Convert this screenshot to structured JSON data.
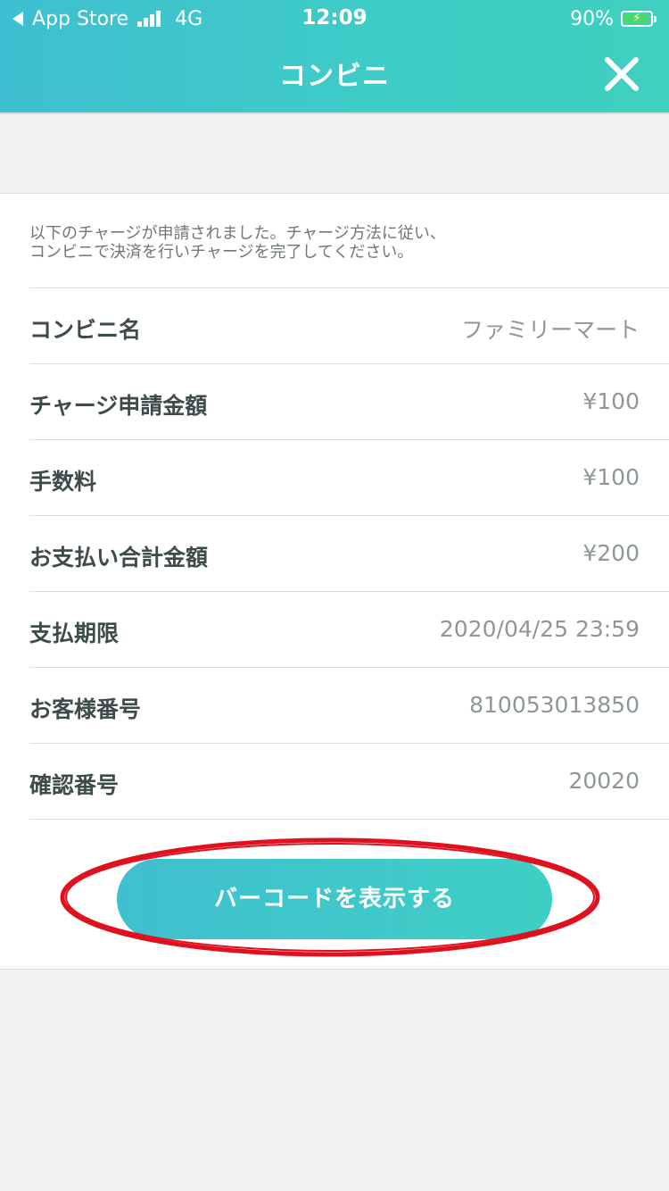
{
  "status_bar": {
    "back_app": "App Store",
    "network": "4G",
    "time": "12:09",
    "battery": "90%",
    "battery_level": 0.9,
    "battery_color": "#4cd964"
  },
  "nav": {
    "title": "コンビニ",
    "close_icon": "close-icon"
  },
  "notice": {
    "line1": "以下のチャージが申請されました。チャージ方法に従い、",
    "line2": "コンビニで決済を行いチャージを完了してください。"
  },
  "details": [
    {
      "label": "コンビニ名",
      "value": "ファミリーマート"
    },
    {
      "label": "チャージ申請金額",
      "value": "¥100"
    },
    {
      "label": "手数料",
      "value": "¥100"
    },
    {
      "label": "お支払い合計金額",
      "value": "¥200"
    },
    {
      "label": "支払期限",
      "value": "2020/04/25 23:59"
    },
    {
      "label": "お客様番号",
      "value": "810053013850"
    },
    {
      "label": "確認番号",
      "value": "20020"
    }
  ],
  "barcode_button": {
    "label": "バーコードを表示する"
  },
  "colors": {
    "accent": "#3ecdc6",
    "annotation": "#e0101f"
  }
}
